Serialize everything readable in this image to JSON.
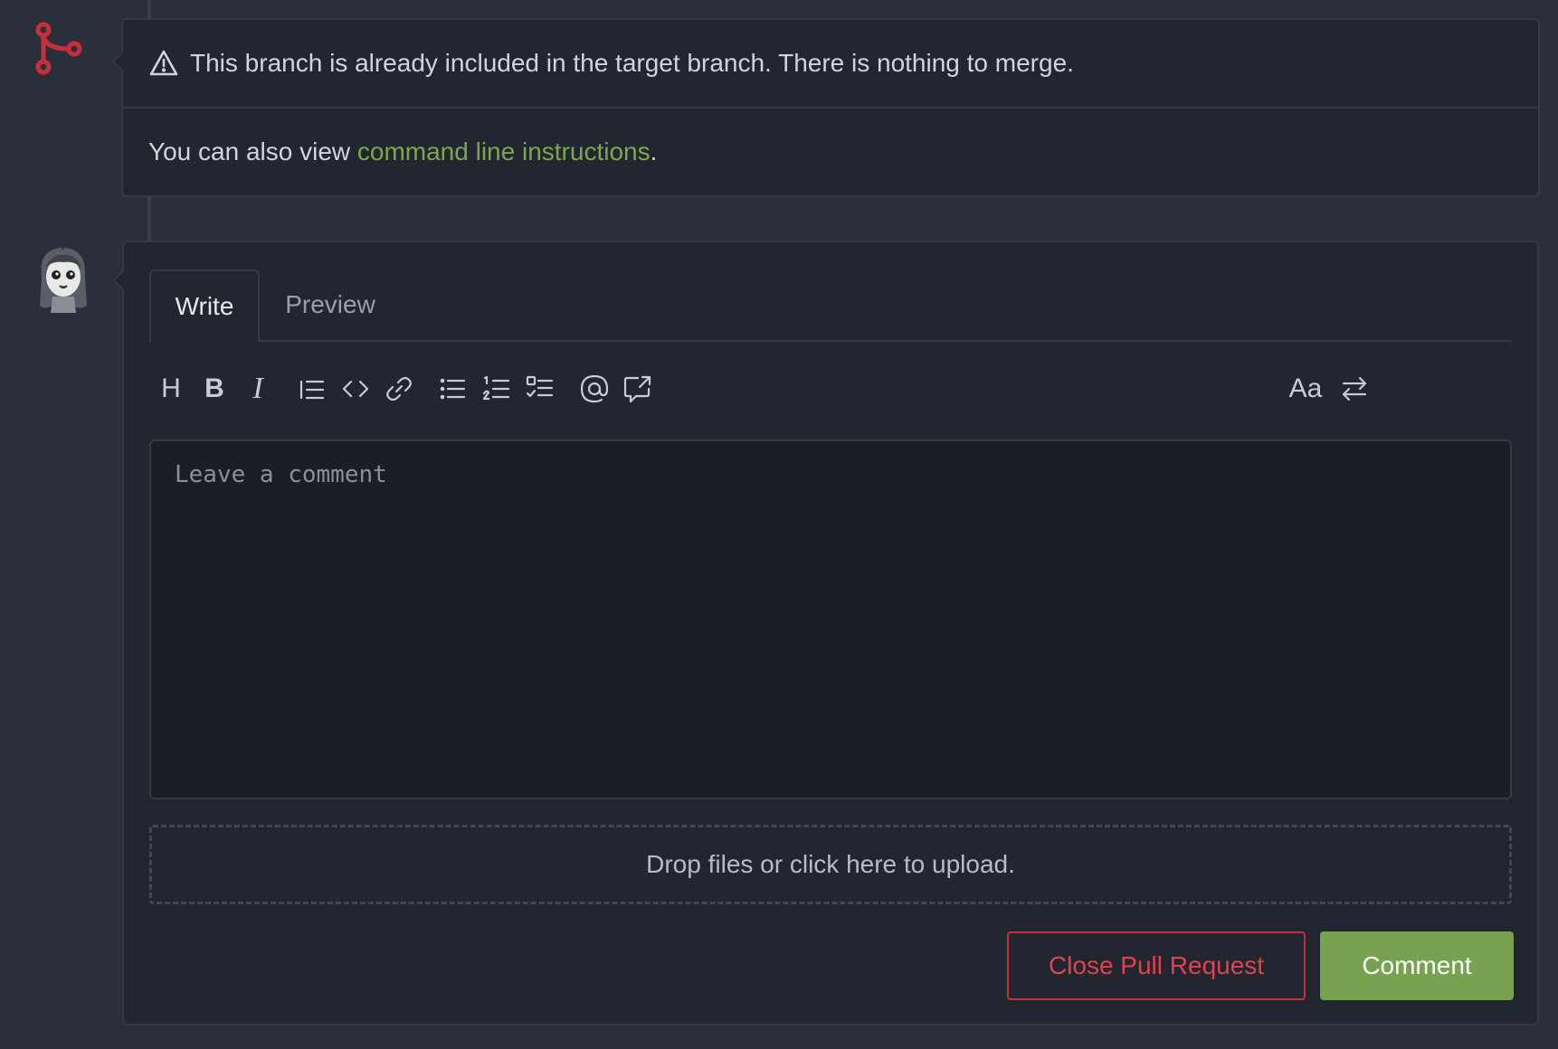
{
  "merge_box": {
    "message": "This branch is already included in the target branch. There is nothing to merge.",
    "instructions_prefix": "You can also view ",
    "instructions_link": "command line instructions",
    "instructions_suffix": "."
  },
  "editor": {
    "tabs": [
      {
        "label": "Write",
        "active": true
      },
      {
        "label": "Preview",
        "active": false
      }
    ],
    "toolbar": {
      "heading": "H",
      "bold": "B",
      "italic": "I",
      "font_toggle": "Aa"
    },
    "comment_placeholder": "Leave a comment",
    "dropzone_text": "Drop files or click here to upload."
  },
  "actions": {
    "close_label": "Close Pull Request",
    "comment_label": "Comment"
  },
  "colors": {
    "background": "#2b2f3b",
    "card": "#222631",
    "accent_green": "#77a350",
    "danger_red": "#c7303a",
    "merge_icon_red": "#c6303a"
  }
}
